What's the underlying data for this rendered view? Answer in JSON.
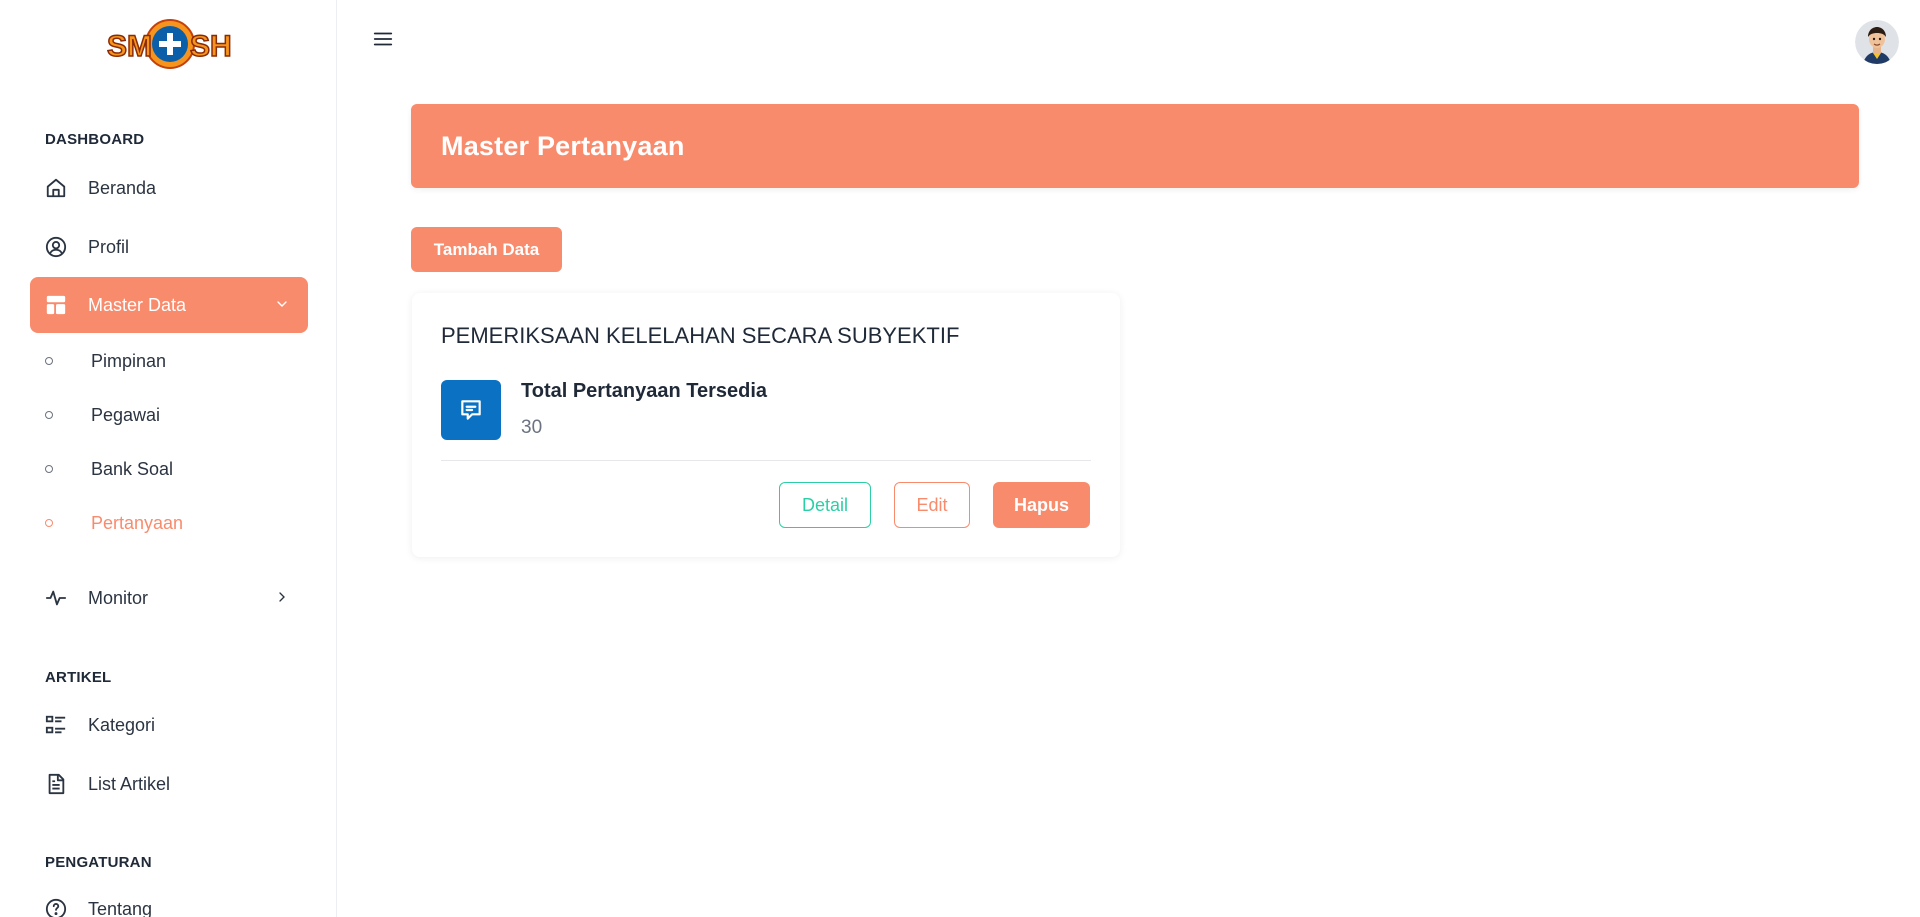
{
  "brand": {
    "logo_text": "SM+SH"
  },
  "sidebar": {
    "sections": [
      {
        "title": "DASHBOARD"
      },
      {
        "title": "ARTIKEL"
      },
      {
        "title": "PENGATURAN"
      }
    ],
    "items": [
      {
        "label": "Beranda",
        "icon": "home-icon"
      },
      {
        "label": "Profil",
        "icon": "user-circle-icon"
      },
      {
        "label": "Master Data",
        "icon": "layout-grid-icon",
        "active": true,
        "expanded": true
      },
      {
        "label": "Monitor",
        "icon": "activity-icon"
      },
      {
        "label": "Kategori",
        "icon": "list-icon"
      },
      {
        "label": "List Artikel",
        "icon": "file-text-icon"
      },
      {
        "label": "Tentang",
        "icon": "help-circle-icon"
      }
    ],
    "submenu": [
      {
        "label": "Pimpinan"
      },
      {
        "label": "Pegawai"
      },
      {
        "label": "Bank Soal"
      },
      {
        "label": "Pertanyaan",
        "current": true
      }
    ]
  },
  "header": {
    "menu_icon": "hamburger-icon",
    "avatar_icon": "user-avatar"
  },
  "main": {
    "title": "Master Pertanyaan",
    "add_button": "Tambah Data",
    "card": {
      "title": "PEMERIKSAAN KELELAHAN SECARA SUBYEKTIF",
      "stat_icon": "message-icon",
      "stat_label": "Total Pertanyaan Tersedia",
      "stat_value": "30",
      "buttons": {
        "detail": "Detail",
        "edit": "Edit",
        "delete": "Hapus"
      }
    }
  },
  "colors": {
    "accent": "#f98b6d",
    "primary_blue": "#0b71c2",
    "teal": "#2ccfa5",
    "text": "#1f2937"
  }
}
